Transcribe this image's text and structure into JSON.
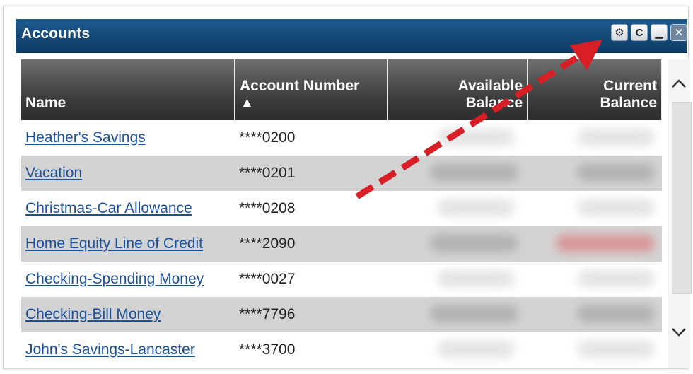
{
  "panel": {
    "title": "Accounts"
  },
  "toolbar": {
    "settings_icon": "gear-icon",
    "refresh_icon": "refresh-icon",
    "minimize_icon": "minimize-icon",
    "close_icon": "close-icon",
    "settings_glyph": "⚙",
    "refresh_glyph": "C",
    "minimize_glyph": "▁",
    "close_glyph": "✕"
  },
  "table": {
    "columns": {
      "name": "Name",
      "account_number": "Account Number",
      "account_number_sort": "▲",
      "available_line1": "Available",
      "available_line2": "Balance",
      "current_line1": "Current",
      "current_line2": "Balance"
    },
    "rows": [
      {
        "name": "Heather's Savings",
        "account": "****0200"
      },
      {
        "name": "Vacation",
        "account": "****0201"
      },
      {
        "name": "Christmas-Car Allowance",
        "account": "****0208"
      },
      {
        "name": "Home Equity Line of Credit",
        "account": "****2090"
      },
      {
        "name": "Checking-Spending Money",
        "account": "****0027"
      },
      {
        "name": "Checking-Bill Money",
        "account": "****7796"
      },
      {
        "name": "John's Savings-Lancaster",
        "account": "****3700"
      }
    ]
  },
  "annotation": {
    "arrow_color": "#d91f26"
  },
  "colors": {
    "titlebar": "#144978",
    "header": "#3f3f3f",
    "link": "#1a4f9a",
    "alt_row": "#d3d3d3"
  }
}
